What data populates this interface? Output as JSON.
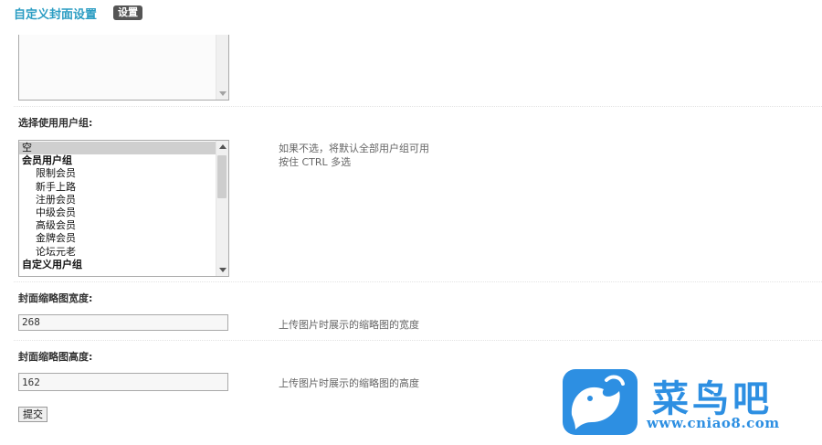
{
  "header": {
    "title": "自定义封面设置",
    "badge": "设置"
  },
  "usergroup": {
    "label": "选择使用用户组:",
    "options": [
      {
        "text": "空",
        "kind": "plain",
        "selected": true
      },
      {
        "text": "会员用户组",
        "kind": "group",
        "selected": false
      },
      {
        "text": "限制会员",
        "kind": "child",
        "selected": false
      },
      {
        "text": "新手上路",
        "kind": "child",
        "selected": false
      },
      {
        "text": "注册会员",
        "kind": "child",
        "selected": false
      },
      {
        "text": "中级会员",
        "kind": "child",
        "selected": false
      },
      {
        "text": "高级会员",
        "kind": "child",
        "selected": false
      },
      {
        "text": "金牌会员",
        "kind": "child",
        "selected": false
      },
      {
        "text": "论坛元老",
        "kind": "child",
        "selected": false
      },
      {
        "text": "自定义用户组",
        "kind": "group",
        "selected": false
      }
    ],
    "hint_line1": "如果不选，将默认全部用户组可用",
    "hint_line2": "按住 CTRL 多选"
  },
  "width_field": {
    "label": "封面缩略图宽度:",
    "value": "268",
    "hint": "上传图片时展示的缩略图的宽度"
  },
  "height_field": {
    "label": "封面缩略图高度:",
    "value": "162",
    "hint": "上传图片时展示的缩略图的高度"
  },
  "submit_label": "提交",
  "watermark": {
    "brand": "菜鸟吧",
    "url": "www.cniao8.com",
    "color": "#2d8fe2"
  }
}
